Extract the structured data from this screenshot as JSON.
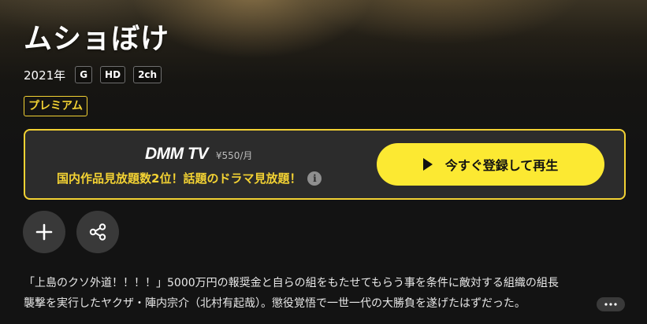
{
  "header": {
    "title": "ムショぼけ",
    "year": "2021年",
    "badges": [
      "G",
      "HD",
      "2ch"
    ]
  },
  "premium_label": "プレミアム",
  "subscribe": {
    "brand": "DMM TV",
    "price": "¥550/月",
    "promo": "国内作品見放題数2位！話題のドラマ見放題！",
    "info_icon": "info-icon",
    "play_label": "今すぐ登録して再生",
    "play_icon": "play-icon"
  },
  "actions": {
    "add_icon": "plus-icon",
    "share_icon": "share-icon"
  },
  "synopsis": {
    "line1": "「上島のクソ外道！！！！」5000万円の報奨金と自らの組をもたせてもらう事を条件に敵対する組織の組長",
    "line2": "襲撃を実行したヤクザ・陣内宗介（北村有起哉）。懲役覚悟で一世一代の大勝負を遂げたはずだった。",
    "more_icon": "ellipsis-icon"
  },
  "colors": {
    "accent": "#f3d233",
    "play_button": "#fce932",
    "background": "#131313",
    "panel": "#2c2c2c"
  }
}
